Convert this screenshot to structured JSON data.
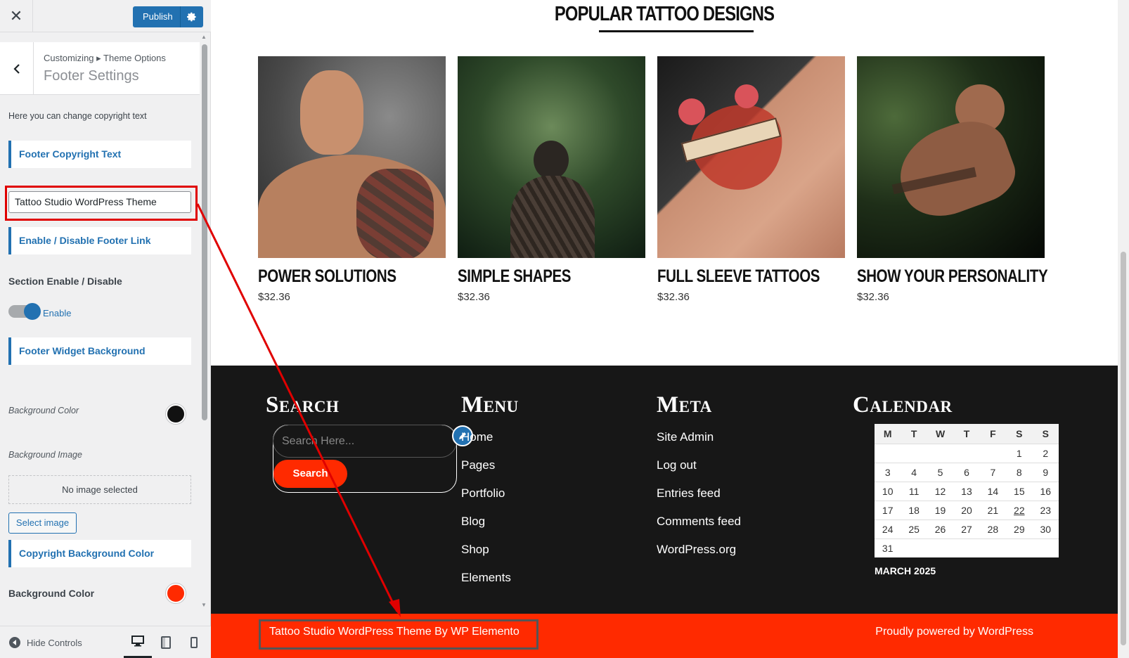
{
  "sidebar": {
    "topbar": {
      "close_glyph": "✕",
      "publish_label": "Publish"
    },
    "section": {
      "breadcrumb": "Customizing ▸ Theme Options",
      "title": "Footer Settings"
    },
    "description": "Here you can change copyright text",
    "groups": {
      "footer_copyright": "Footer Copyright Text",
      "footer_link": "Enable / Disable Footer Link",
      "footer_widget_bg": "Footer Widget Background",
      "copyright_bg": "Copyright Background Color"
    },
    "copyright_input_value": "Tattoo Studio WordPress Theme",
    "section_enable_label": "Section Enable / Disable",
    "toggle_label": "Enable",
    "background_color_label": "Background Color",
    "background_image_label": "Background Image",
    "no_image_text": "No image selected",
    "select_image_label": "Select image",
    "copyright_bg_color_label": "Background Color",
    "colors": {
      "widget_bg": "#111111",
      "copyright_bg": "#ff2a00"
    },
    "bottom": {
      "hide_controls_label": "Hide Controls"
    }
  },
  "preview": {
    "section_title": "POPULAR TATTOO DESIGNS",
    "products": [
      {
        "name": "POWER SOLUTIONS",
        "price": "$32.36"
      },
      {
        "name": "SIMPLE SHAPES",
        "price": "$32.36"
      },
      {
        "name": "FULL SLEEVE TATTOOS",
        "price": "$32.36"
      },
      {
        "name": "SHOW YOUR PERSONALITY",
        "price": "$32.36"
      }
    ],
    "footer": {
      "search": {
        "title": "Search",
        "placeholder": "Search Here...",
        "button": "Search"
      },
      "menu": {
        "title": "Menu",
        "items": [
          "Home",
          "Pages",
          "Portfolio",
          "Blog",
          "Shop",
          "Elements"
        ]
      },
      "meta": {
        "title": "Meta",
        "items": [
          "Site Admin",
          "Log out",
          "Entries feed",
          "Comments feed",
          "WordPress.org"
        ]
      },
      "calendar": {
        "title": "Calendar",
        "days": [
          "M",
          "T",
          "W",
          "T",
          "F",
          "S",
          "S"
        ],
        "weeks": [
          [
            "",
            "",
            "",
            "",
            "",
            "1",
            "2"
          ],
          [
            "3",
            "4",
            "5",
            "6",
            "7",
            "8",
            "9"
          ],
          [
            "10",
            "11",
            "12",
            "13",
            "14",
            "15",
            "16"
          ],
          [
            "17",
            "18",
            "19",
            "20",
            "21",
            "22",
            "23"
          ],
          [
            "24",
            "25",
            "26",
            "27",
            "28",
            "29",
            "30"
          ],
          [
            "31",
            "",
            "",
            "",
            "",
            "",
            ""
          ]
        ],
        "today": "22",
        "caption": "MARCH 2025"
      }
    },
    "copyright_text": "Tattoo Studio WordPress Theme By WP Elemento",
    "powered_text": "Proudly powered by WordPress"
  }
}
